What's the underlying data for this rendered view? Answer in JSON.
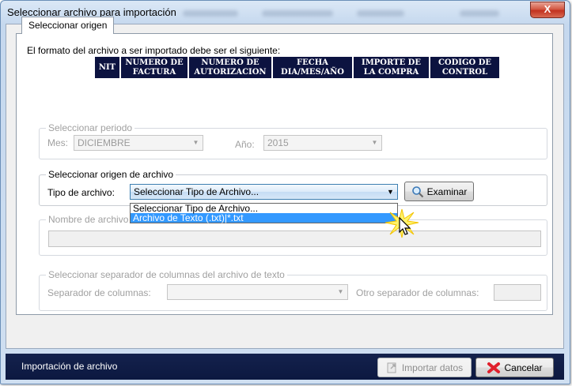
{
  "window": {
    "title": "Seleccionar archivo para importación",
    "close_glyph": "X"
  },
  "tab": {
    "label": "Seleccionar origen"
  },
  "format": {
    "intro": "El formato del archivo a ser importado debe ser el siguiente:",
    "columns": [
      {
        "line1": "NIT",
        "line2": ""
      },
      {
        "line1": "NUMERO DE",
        "line2": "FACTURA"
      },
      {
        "line1": "NUMERO DE",
        "line2": "AUTORIZACION"
      },
      {
        "line1": "FECHA",
        "line2": "DIA/MES/AÑO"
      },
      {
        "line1": "IMPORTE DE",
        "line2": "LA COMPRA"
      },
      {
        "line1": "CODIGO DE",
        "line2": "CONTROL"
      }
    ]
  },
  "period": {
    "legend": "Seleccionar periodo",
    "month_label": "Mes:",
    "month_value": "DICIEMBRE",
    "year_label": "Año:",
    "year_value": "2015"
  },
  "origin": {
    "legend": "Seleccionar origen de archivo",
    "type_label": "Tipo de archivo:",
    "type_value": "Seleccionar Tipo de Archivo...",
    "options": [
      "Seleccionar Tipo de Archivo...",
      "Archivo de Texto (.txt)|*.txt"
    ],
    "browse_label": "Examinar"
  },
  "filename": {
    "legend": "Nombre de archivo"
  },
  "separator": {
    "legend": "Seleccionar separador de columnas del archivo de texto",
    "columns_label": "Separador de columnas:",
    "other_label": "Otro separador de columnas:"
  },
  "footer": {
    "status": "Importación de archivo",
    "import_label": "Importar datos",
    "cancel_label": "Cancelar"
  },
  "colors": {
    "header_bg": "#0c1340",
    "status_bg": "#14224d",
    "selection": "#3399ff",
    "cancel_icon": "#e0202c"
  }
}
